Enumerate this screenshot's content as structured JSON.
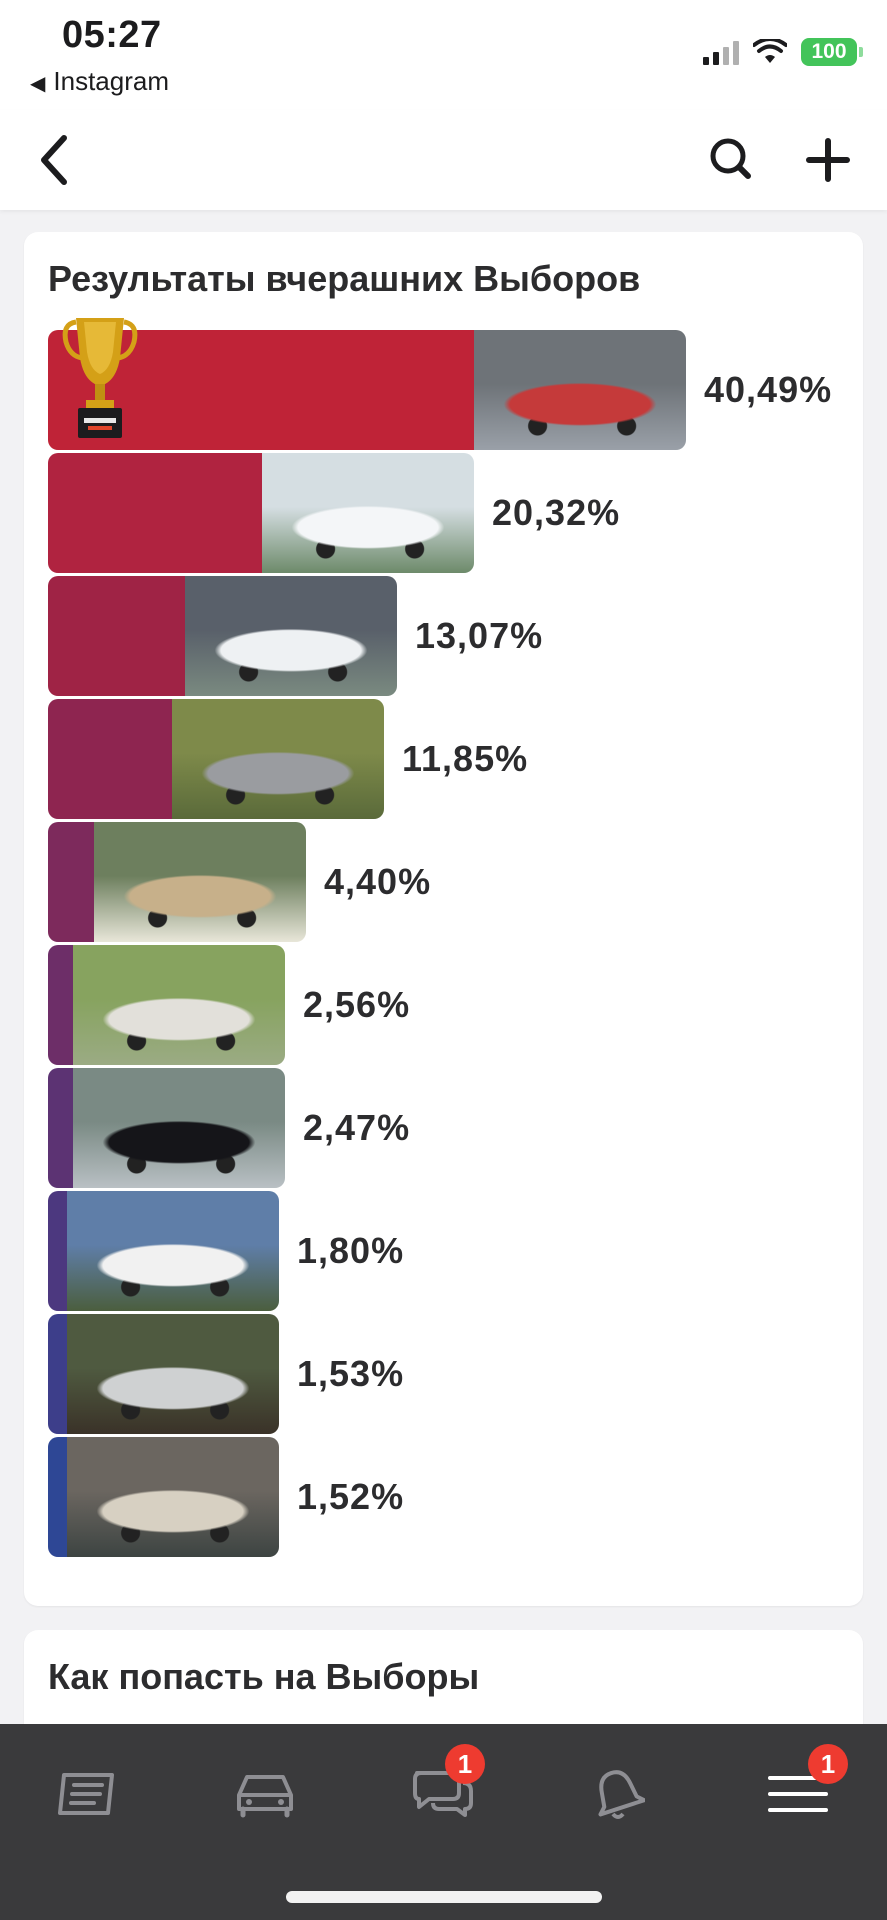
{
  "status_bar": {
    "time": "05:27",
    "back_app": "Instagram",
    "battery": "100"
  },
  "results": {
    "title": "Результаты вчерашних Выборов",
    "items": [
      {
        "percent": "40,49%",
        "value": 40.49,
        "color": "#bf2337",
        "photo": "red-convertible-photo"
      },
      {
        "percent": "20,32%",
        "value": 20.32,
        "color": "#b02340",
        "photo": "white-suv-photo"
      },
      {
        "percent": "13,07%",
        "value": 13.07,
        "color": "#9f2345",
        "photo": "white-sedan-photo"
      },
      {
        "percent": "11,85%",
        "value": 11.85,
        "color": "#8e2550",
        "photo": "grey-hatchback-photo"
      },
      {
        "percent": "4,40%",
        "value": 4.4,
        "color": "#7d2a5c",
        "photo": "beige-suv-photo"
      },
      {
        "percent": "2,56%",
        "value": 2.56,
        "color": "#6d2e68",
        "photo": "white-minivan-photo"
      },
      {
        "percent": "2,47%",
        "value": 2.47,
        "color": "#5c3373",
        "photo": "black-sedan-photo"
      },
      {
        "percent": "1,80%",
        "value": 1.8,
        "color": "#4c387f",
        "photo": "white-crossover-photo"
      },
      {
        "percent": "1,53%",
        "value": 1.53,
        "color": "#3d3e8a",
        "photo": "silver-wagon-photo"
      },
      {
        "percent": "1,52%",
        "value": 1.52,
        "color": "#2e4795",
        "photo": "silver-sedan-photo"
      }
    ]
  },
  "how_to": {
    "title": "Как попасть на Выборы"
  },
  "tab_bar": {
    "messages_badge": "1",
    "menu_badge": "1"
  }
}
